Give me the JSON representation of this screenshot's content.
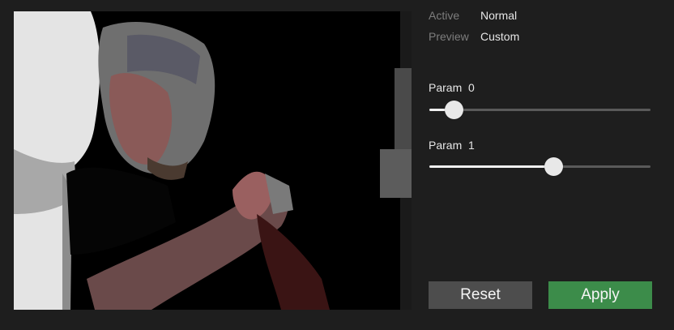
{
  "info": {
    "active_label": "Active",
    "active_value": "Normal",
    "preview_label": "Preview",
    "preview_value": "Custom"
  },
  "params": [
    {
      "label": "Param  0",
      "value_fraction": 0.11
    },
    {
      "label": "Param  1",
      "value_fraction": 0.56
    }
  ],
  "buttons": {
    "reset_label": "Reset",
    "apply_label": "Apply"
  },
  "colors": {
    "background": "#1e1e1e",
    "track": "#5a5a5a",
    "thumb": "#e8e8e8",
    "reset_bg": "#4d4d4d",
    "apply_bg": "#3c8c4a"
  }
}
